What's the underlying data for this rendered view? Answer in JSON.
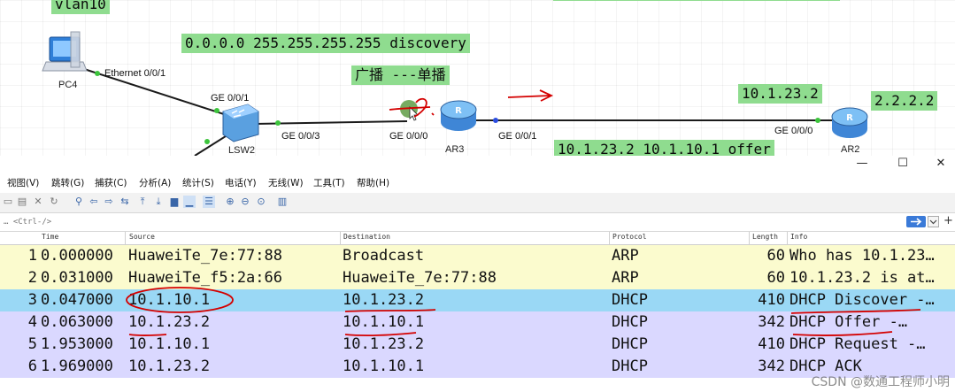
{
  "topology": {
    "labels": {
      "vlan": "vlan10",
      "discovery": "0.0.0.0 255.255.255.255 discovery",
      "broadcast_unicast": "广播 ---单播",
      "router_ip": "10.1.23.2",
      "remote_ip": "2.2.2.2",
      "offer": "10.1.23.2 10.1.10.1 offer"
    },
    "devices": {
      "pc": "PC4",
      "switch": "LSW2",
      "router_mid": "AR3",
      "router_right": "AR2"
    },
    "ports": {
      "pc_eth": "Ethernet 0/0/1",
      "sw_ge001": "GE 0/0/1",
      "sw_ge003": "GE 0/0/3",
      "ar3_ge000": "GE 0/0/0",
      "ar3_ge001": "GE 0/0/1",
      "ar2_ge000": "GE 0/0/0"
    },
    "link_color": "#1a1a1a",
    "label_bg": "#8fdc8f"
  },
  "window": {
    "minimize": "—",
    "maximize": "☐",
    "close": "✕"
  },
  "menu": [
    "视图(V)",
    "跳转(G)",
    "捕获(C)",
    "分析(A)",
    "统计(S)",
    "电话(Y)",
    "无线(W)",
    "工具(T)",
    "帮助(H)"
  ],
  "filter": {
    "placeholder": "… <Ctrl-/>",
    "apply_icon": "arrow-right-icon",
    "dropdown_icon": "chevron-down-icon",
    "add_icon": "plus-icon"
  },
  "columns": {
    "time": "Time",
    "source": "Source",
    "destination": "Destination",
    "protocol": "Protocol",
    "length": "Length",
    "info": "Info"
  },
  "packets": [
    {
      "no": "1",
      "time": "0.000000",
      "source": "HuaweiTe_7e:77:88",
      "destination": "Broadcast",
      "protocol": "ARP",
      "length": "60",
      "info": "Who has 10.1.23…"
    },
    {
      "no": "2",
      "time": "0.031000",
      "source": "HuaweiTe_f5:2a:66",
      "destination": "HuaweiTe_7e:77:88",
      "protocol": "ARP",
      "length": "60",
      "info": "10.1.23.2 is at…"
    },
    {
      "no": "3",
      "time": "0.047000",
      "source": "10.1.10.1",
      "destination": "10.1.23.2",
      "protocol": "DHCP",
      "length": "410",
      "info": "DHCP Discover -…"
    },
    {
      "no": "4",
      "time": "0.063000",
      "source": "10.1.23.2",
      "destination": "10.1.10.1",
      "protocol": "DHCP",
      "length": "342",
      "info": "DHCP Offer    -…"
    },
    {
      "no": "5",
      "time": "1.953000",
      "source": "10.1.10.1",
      "destination": "10.1.23.2",
      "protocol": "DHCP",
      "length": "410",
      "info": "DHCP Request  -…"
    },
    {
      "no": "6",
      "time": "1.969000",
      "source": "10.1.23.2",
      "destination": "10.1.10.1",
      "protocol": "DHCP",
      "length": "342",
      "info": "DHCP ACK"
    }
  ],
  "row_colors": {
    "arp": "#fbfbce",
    "dhcp": "#dad8ff",
    "selected": "#9ad8f5"
  },
  "annotation_color": "#d40000",
  "watermark": "CSDN @数通工程师小明"
}
